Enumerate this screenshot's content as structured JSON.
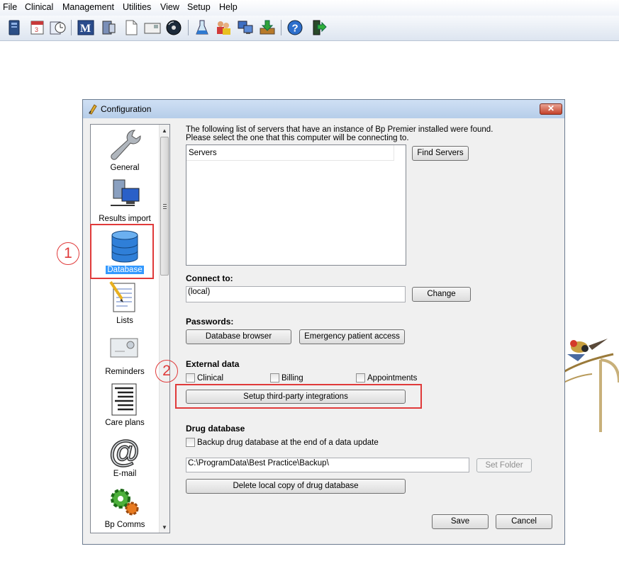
{
  "menu": [
    "File",
    "Clinical",
    "Management",
    "Utilities",
    "View",
    "Setup",
    "Help"
  ],
  "toolbar_icons": [
    "patient-file-icon",
    "appointment-book-icon",
    "waiting-room-icon",
    "mims-icon",
    "drug-icon",
    "blank-document-icon",
    "letter-icon",
    "cd-icon",
    "flask-icon",
    "users-icon",
    "computers-icon",
    "download-icon",
    "help-icon",
    "exit-icon"
  ],
  "dialog": {
    "title": "Configuration",
    "close_symbol": "✕",
    "sidebar": [
      {
        "label": "General",
        "icon": "wrench-icon"
      },
      {
        "label": "Results import",
        "icon": "server-network-icon"
      },
      {
        "label": "Database",
        "icon": "database-icon",
        "selected": true
      },
      {
        "label": "Lists",
        "icon": "notepad-icon"
      },
      {
        "label": "Reminders",
        "icon": "envelope-icon"
      },
      {
        "label": "Care plans",
        "icon": "list-document-icon"
      },
      {
        "label": "E-mail",
        "icon": "at-sign-icon"
      },
      {
        "label": "Bp Comms",
        "icon": "gears-icon"
      }
    ],
    "intro_line1": "The following list of servers that have an instance of Bp Premier installed were found.",
    "intro_line2": "Please select the one that this computer will be connecting to.",
    "servers_header": "Servers",
    "find_servers": "Find Servers",
    "connect_heading": "Connect to:",
    "connect_value": "(local)",
    "change": "Change",
    "passwords_heading": "Passwords:",
    "db_browser": "Database browser",
    "emergency": "Emergency patient access",
    "external_heading": "External data",
    "cb_clinical": "Clinical",
    "cb_billing": "Billing",
    "cb_appointments": "Appointments",
    "setup_integrations": "Setup third-party integrations",
    "drug_heading": "Drug database",
    "cb_backup": "Backup drug database at the end of a data update",
    "folder_path": "C:\\ProgramData\\Best Practice\\Backup\\",
    "set_folder": "Set Folder",
    "delete_local": "Delete local copy of drug database",
    "save": "Save",
    "cancel": "Cancel"
  },
  "annotations": {
    "one": "1",
    "two": "2",
    "color": "#e03a3a"
  },
  "colors": {
    "selection": "#3399ff",
    "titlebar": "#b6cde9"
  }
}
